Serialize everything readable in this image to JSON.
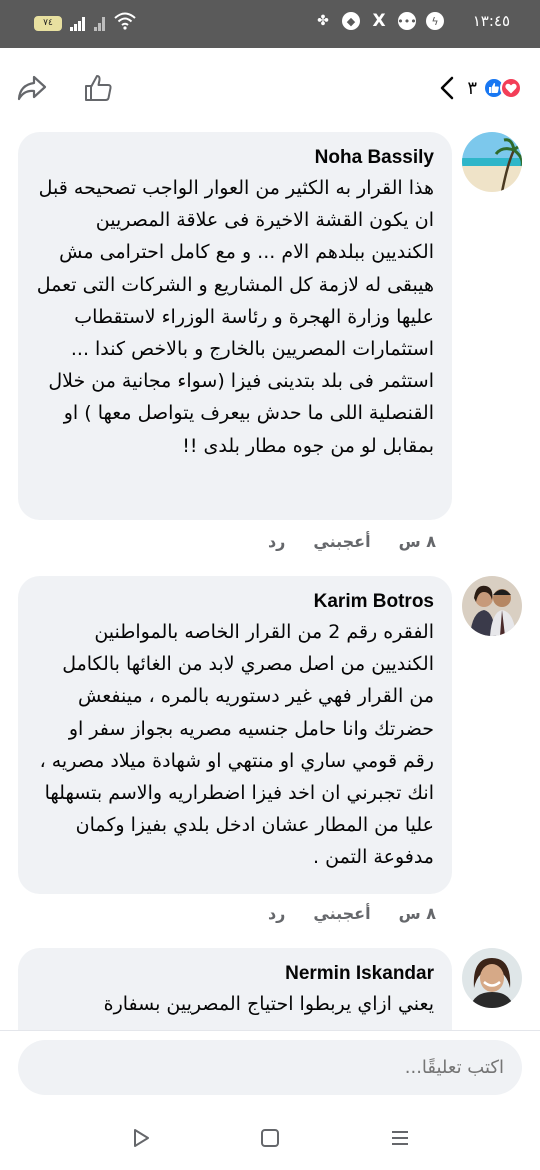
{
  "status_bar": {
    "time": "١٣:٤٥",
    "battery": "٧٤"
  },
  "header": {
    "reaction_count": "٣"
  },
  "comments": [
    {
      "author": "Noha Bassily",
      "text": "هذا القرار به الكثير من العوار الواجب تصحيحه قبل ان يكون القشة الاخيرة فى علاقة المصريين الكنديين ببلدهم الام ... و مع كامل احترامى مش هيبقى له لازمة كل المشاريع و الشركات التى تعمل عليها وزارة الهجرة و رئاسة الوزراء لاستقطاب استثمارات المصريين بالخارج و بالاخص كندا ... استثمر فى بلد بتدينى فيزا (سواء مجانية من خلال القنصلية اللى ما حدش بيعرف يتواصل معها ) او بمقابل لو من جوه مطار بلدى !!",
      "time": "٨ س",
      "like_label": "أعجبني",
      "reply_label": "رد"
    },
    {
      "author": "Karim Botros",
      "text": "الفقره رقم 2 من القرار الخاصه بالمواطنين الكنديين من اصل مصري لابد من الغائها بالكامل من القرار فهي غير دستوريه بالمره ، مينفعش حضرتك وانا حامل جنسيه مصريه بجواز سفر او رقم قومي ساري او منتهي او شهادة ميلاد مصريه ، انك تجبرني ان اخد فيزا اضطراريه والاسم بتسهلها عليا من المطار عشان ادخل بلدي بفيزا وكمان مدفوعة التمن .",
      "time": "٨ س",
      "like_label": "أعجبني",
      "reply_label": "رد"
    },
    {
      "author": "Nermin Iskandar",
      "text": "يعني ازاي يربطوا احتياج المصريين بسفارة",
      "time": "",
      "like_label": "",
      "reply_label": ""
    }
  ],
  "comment_input": {
    "placeholder": "اكتب تعليقًا..."
  },
  "colors": {
    "status_bar_bg": "#5a5a5a",
    "bubble_bg": "#f0f2f5",
    "like_blue": "#1877f2",
    "love_red": "#f33e58",
    "secondary_text": "#65676b"
  }
}
